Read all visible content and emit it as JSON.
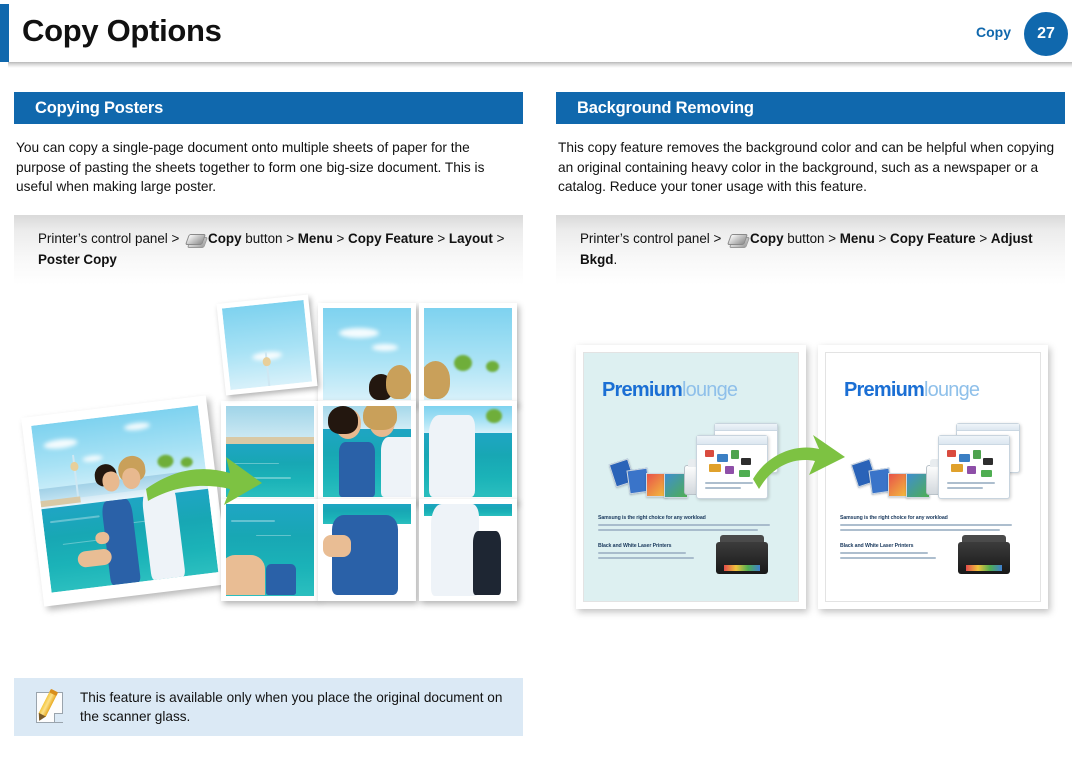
{
  "header": {
    "title": "Copy Options",
    "chapter_label": "Copy",
    "page_number": "27",
    "accent_color": "#1068ad"
  },
  "left_column": {
    "section_title": "Copying Posters",
    "body": "You can copy a single-page document onto multiple sheets of paper for the purpose of pasting the sheets together to form one big-size document. This is useful when making large poster.",
    "path": {
      "prefix": "Printer’s control panel >",
      "icon": "copy-button-icon",
      "segments": [
        {
          "text": "Copy",
          "bold": true
        },
        {
          "text": "button >",
          "bold": false
        },
        {
          "text": "Menu",
          "bold": true
        },
        {
          "text": ">",
          "bold": false
        },
        {
          "text": "Copy Feature",
          "bold": true
        },
        {
          "text": ">",
          "bold": false
        },
        {
          "text": "Layout",
          "bold": true
        },
        {
          "text": ">",
          "bold": false
        },
        {
          "text": "Poster Copy",
          "bold": true
        }
      ]
    },
    "figure": {
      "name": "poster-copy-illustration",
      "source_photo_alt": "Photo of two people sitting by the waterfront",
      "arrow_color": "#7dc242",
      "tile_rows": 3,
      "tile_cols": 3
    }
  },
  "right_column": {
    "section_title": "Background Removing",
    "body": "This copy feature removes the background color and can be helpful when copying an original containing heavy color in the background, such as a newspaper or a catalog. Reduce your toner usage with this feature.",
    "path": {
      "prefix": "Printer’s control panel >",
      "icon": "copy-button-icon",
      "segments": [
        {
          "text": "Copy",
          "bold": true
        },
        {
          "text": "button >",
          "bold": false
        },
        {
          "text": "Menu",
          "bold": true
        },
        {
          "text": ">",
          "bold": false
        },
        {
          "text": "Copy Feature",
          "bold": true
        },
        {
          "text": ">",
          "bold": false
        },
        {
          "text": "Adjust Bkgd",
          "bold": true
        },
        {
          "text": ".",
          "bold": false
        }
      ]
    },
    "figure": {
      "name": "background-removing-illustration",
      "arrow_color": "#7dc242",
      "brochures": [
        {
          "id": "before",
          "background": "tinted",
          "background_color": "#ddf0f1",
          "logo_primary": "Premium",
          "logo_secondary": "lounge",
          "headline": "Samsung is the right choice for any workload",
          "subheadline": "Black and White Laser Printers"
        },
        {
          "id": "after",
          "background": "plain",
          "background_color": "#ffffff",
          "logo_primary": "Premium",
          "logo_secondary": "lounge",
          "headline": "Samsung is the right choice for any workload",
          "subheadline": "Black and White Laser Printers"
        }
      ]
    }
  },
  "note": {
    "icon": "note-pencil-icon",
    "text": "This feature is available only when you place the original document on the scanner glass.",
    "background_color": "#dbe9f5"
  }
}
